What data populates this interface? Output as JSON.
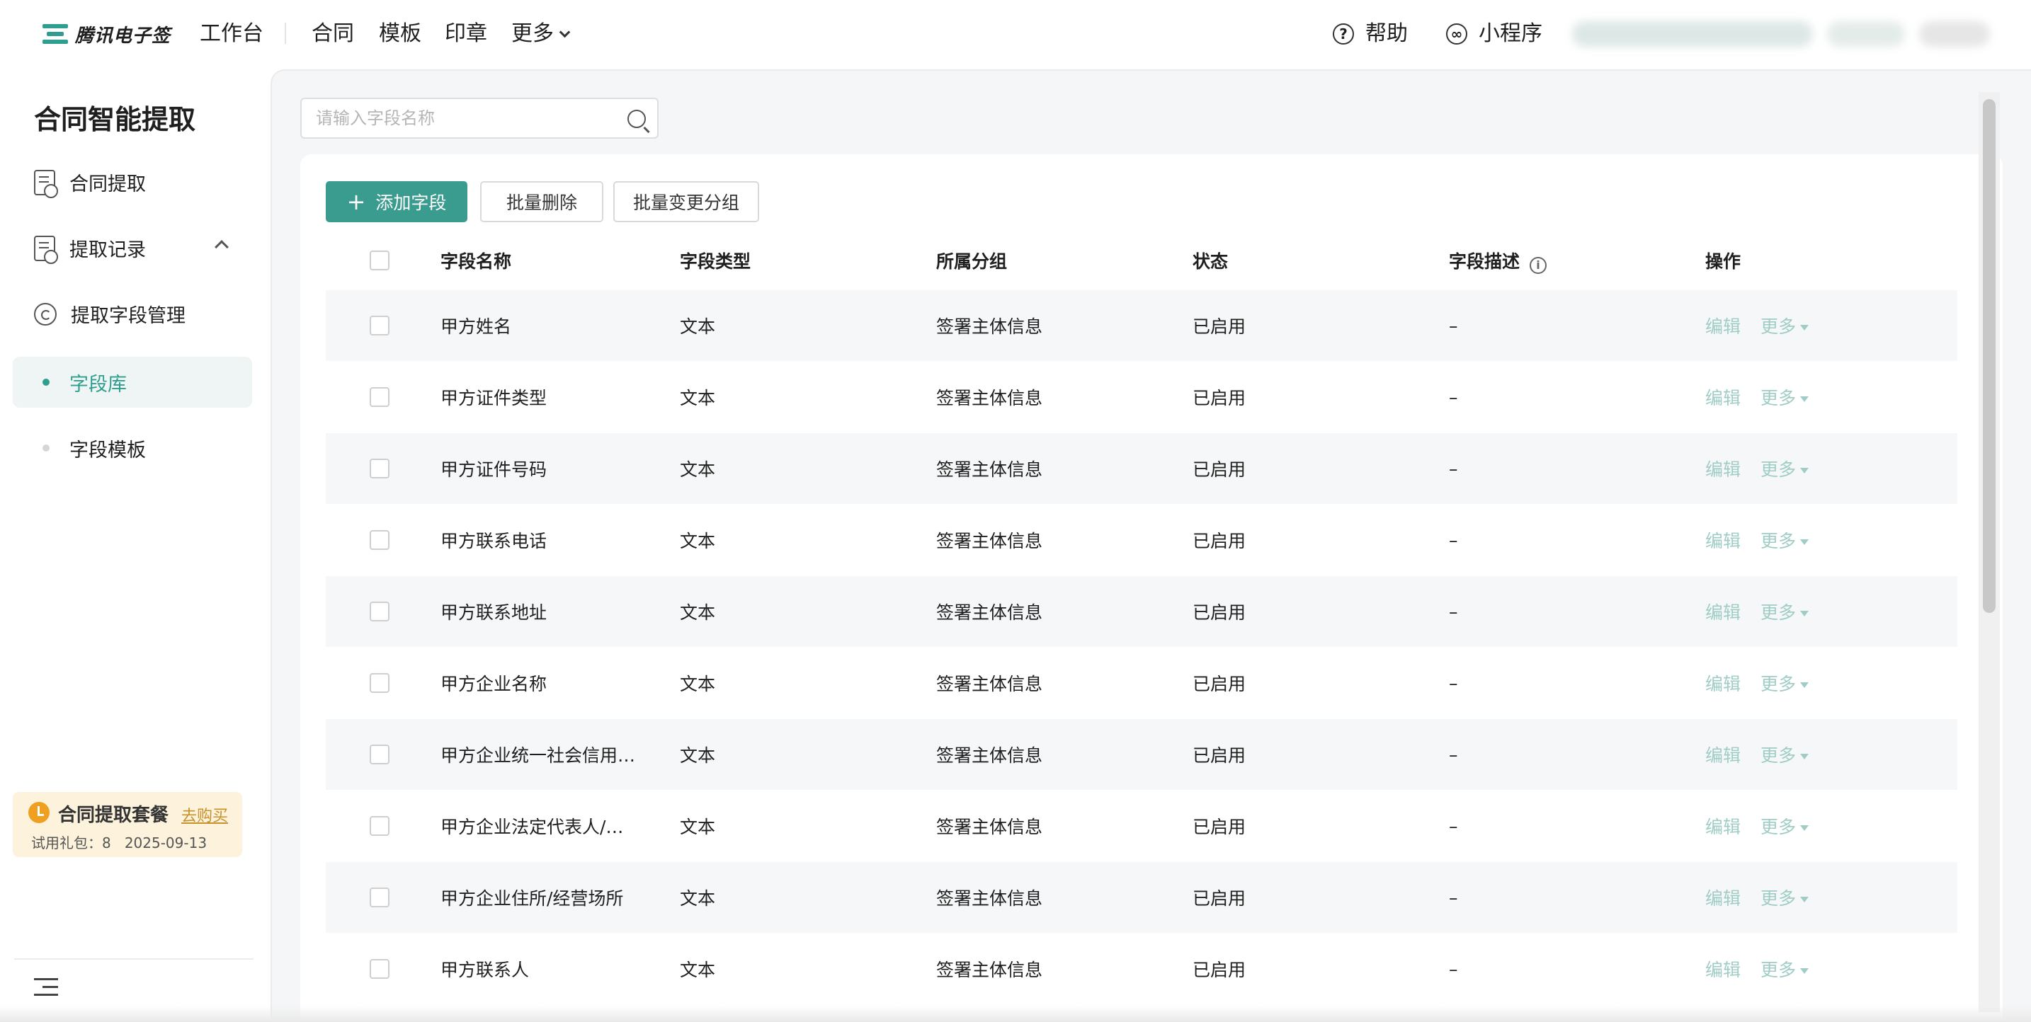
{
  "header": {
    "brand": "腾讯电子签",
    "nav": [
      {
        "id": "workbench",
        "label": "工作台"
      },
      {
        "id": "contract",
        "label": "合同"
      },
      {
        "id": "template",
        "label": "模板"
      },
      {
        "id": "seal",
        "label": "印章"
      },
      {
        "id": "more",
        "label": "更多"
      }
    ],
    "help_label": "帮助",
    "help_icon": "question-circle-icon",
    "miniapp_label": "小程序",
    "miniapp_icon": "link-icon"
  },
  "sidebar": {
    "title": "合同智能提取",
    "items": [
      {
        "label": "合同提取",
        "icon": "document-clock-icon"
      },
      {
        "label": "提取记录",
        "icon": "document-clock-icon"
      },
      {
        "label": "提取字段管理",
        "icon": "refresh-circle-icon",
        "expanded": true
      }
    ],
    "sub_items": [
      {
        "label": "字段库",
        "active": true
      },
      {
        "label": "字段模板",
        "active": false
      }
    ],
    "package": {
      "title": "合同提取套餐",
      "link": "去购买",
      "trial": "试用礼包：8",
      "date": "2025-09-13"
    }
  },
  "main": {
    "search": {
      "placeholder": "请输入字段名称",
      "value": ""
    },
    "toolbar": {
      "add_label": "添加字段",
      "batch_delete_label": "批量删除",
      "batch_group_label": "批量变更分组"
    },
    "table": {
      "columns": {
        "name": "字段名称",
        "type": "字段类型",
        "group": "所属分组",
        "status": "状态",
        "desc": "字段描述",
        "ops": "操作"
      },
      "op_edit": "编辑",
      "op_more": "更多",
      "rows": [
        {
          "name": "甲方姓名",
          "type": "文本",
          "group": "签署主体信息",
          "status": "已启用",
          "desc": "–"
        },
        {
          "name": "甲方证件类型",
          "type": "文本",
          "group": "签署主体信息",
          "status": "已启用",
          "desc": "–"
        },
        {
          "name": "甲方证件号码",
          "type": "文本",
          "group": "签署主体信息",
          "status": "已启用",
          "desc": "–"
        },
        {
          "name": "甲方联系电话",
          "type": "文本",
          "group": "签署主体信息",
          "status": "已启用",
          "desc": "–"
        },
        {
          "name": "甲方联系地址",
          "type": "文本",
          "group": "签署主体信息",
          "status": "已启用",
          "desc": "–"
        },
        {
          "name": "甲方企业名称",
          "type": "文本",
          "group": "签署主体信息",
          "status": "已启用",
          "desc": "–"
        },
        {
          "name": "甲方企业统一社会信用…",
          "type": "文本",
          "group": "签署主体信息",
          "status": "已启用",
          "desc": "–"
        },
        {
          "name": "甲方企业法定代表人/…",
          "type": "文本",
          "group": "签署主体信息",
          "status": "已启用",
          "desc": "–"
        },
        {
          "name": "甲方企业住所/经营场所",
          "type": "文本",
          "group": "签署主体信息",
          "status": "已启用",
          "desc": "–"
        },
        {
          "name": "甲方联系人",
          "type": "文本",
          "group": "签署主体信息",
          "status": "已启用",
          "desc": "–"
        }
      ]
    }
  },
  "colors": {
    "accent": "#3a9c8e",
    "accent_light": "#9fcdc6",
    "active_bg": "#eef5f4",
    "package_bg": "#fdf3dc",
    "package_icon": "#f0a020"
  }
}
